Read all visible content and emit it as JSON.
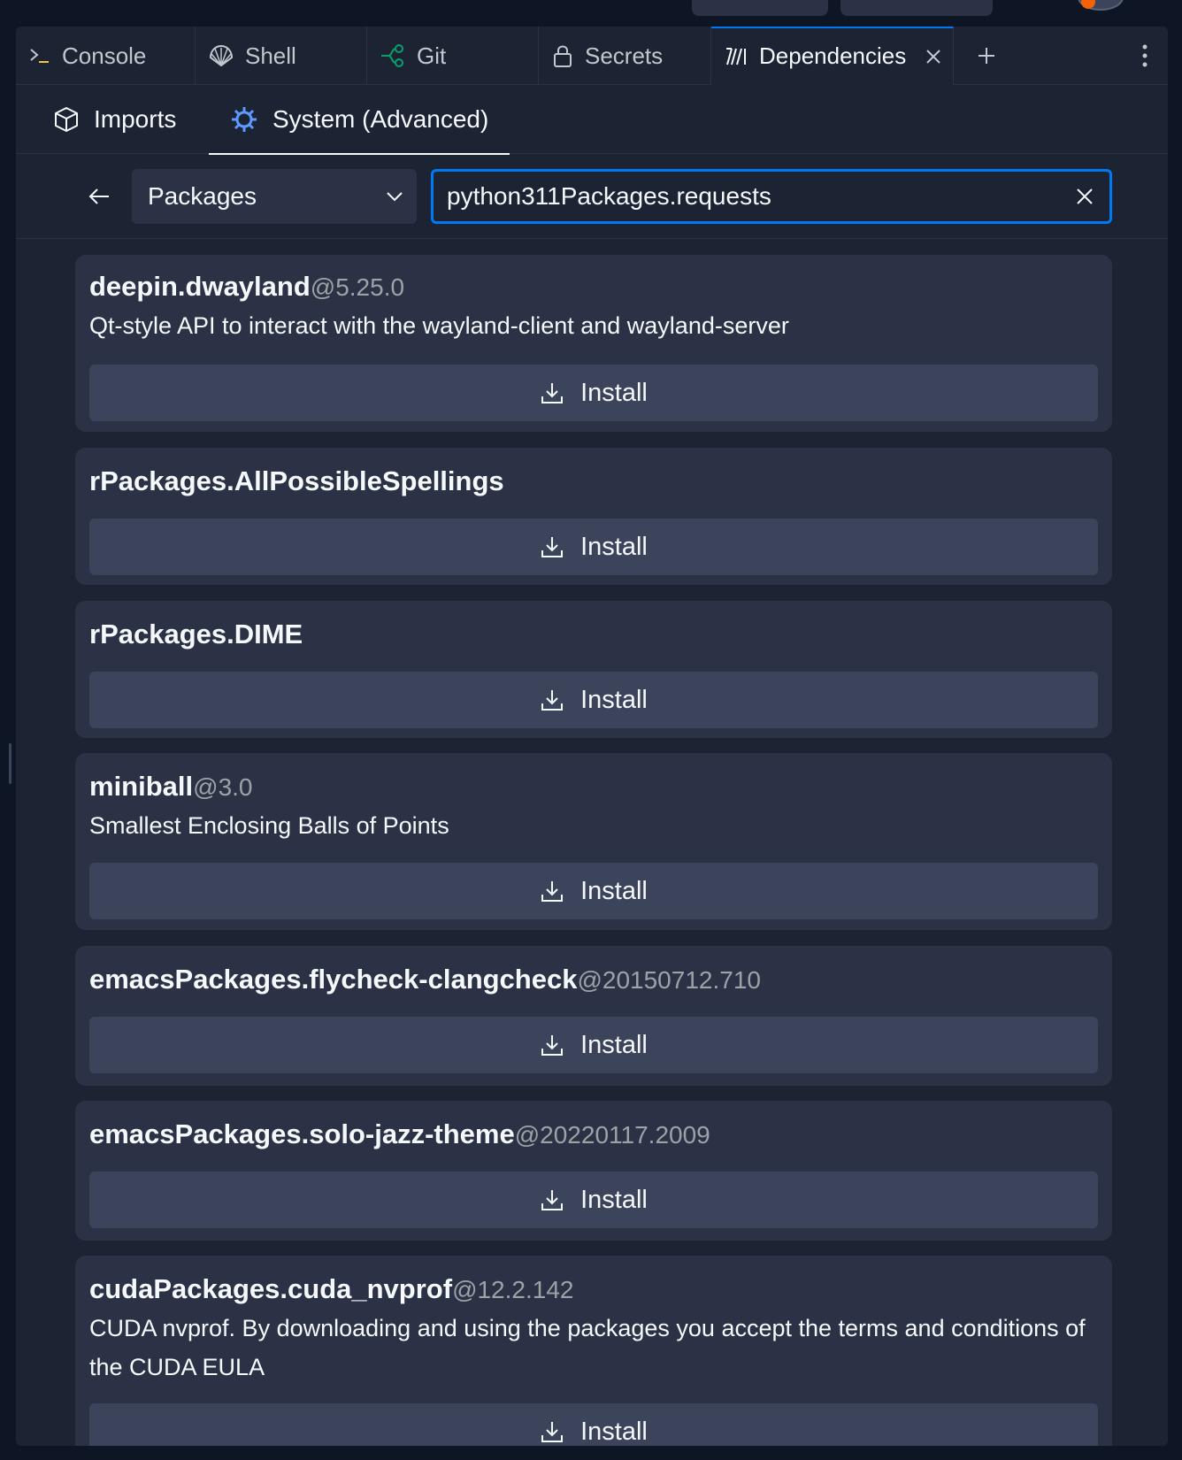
{
  "tabs": [
    {
      "label": "Console",
      "icon": "console-icon"
    },
    {
      "label": "Shell",
      "icon": "shell-icon"
    },
    {
      "label": "Git",
      "icon": "git-icon"
    },
    {
      "label": "Secrets",
      "icon": "lock-icon"
    },
    {
      "label": "Dependencies",
      "icon": "dependencies-icon",
      "active": true
    }
  ],
  "subtabs": [
    {
      "label": "Imports",
      "icon": "cube-icon"
    },
    {
      "label": "System (Advanced)",
      "icon": "nix-icon",
      "active": true
    }
  ],
  "search": {
    "select_value": "Packages",
    "query": "python311Packages.requests"
  },
  "results": [
    {
      "name": "deepin.dwayland",
      "version": "@5.25.0",
      "description": "Qt-style API to interact with the wayland-client and wayland-server",
      "install_label": "Install"
    },
    {
      "name": "rPackages.AllPossibleSpellings",
      "version": "",
      "description": "",
      "install_label": "Install"
    },
    {
      "name": "rPackages.DIME",
      "version": "",
      "description": "",
      "install_label": "Install"
    },
    {
      "name": "miniball",
      "version": "@3.0",
      "description": "Smallest Enclosing Balls of Points",
      "install_label": "Install"
    },
    {
      "name": "emacsPackages.flycheck-clangcheck",
      "version": "@20150712.710",
      "description": "",
      "install_label": "Install"
    },
    {
      "name": "emacsPackages.solo-jazz-theme",
      "version": "@20220117.2009",
      "description": "",
      "install_label": "Install"
    },
    {
      "name": "cudaPackages.cuda_nvprof",
      "version": "@12.2.142",
      "description": "CUDA nvprof. By downloading and using the packages you accept the terms and conditions of the CUDA EULA",
      "install_label": "Install"
    }
  ],
  "colors": {
    "accent": "#0079f2",
    "background": "#1c2333",
    "card": "#2b3245",
    "button": "#3c445c",
    "git_green": "#0a9e6b",
    "nix_blue": "#5c9aff"
  }
}
